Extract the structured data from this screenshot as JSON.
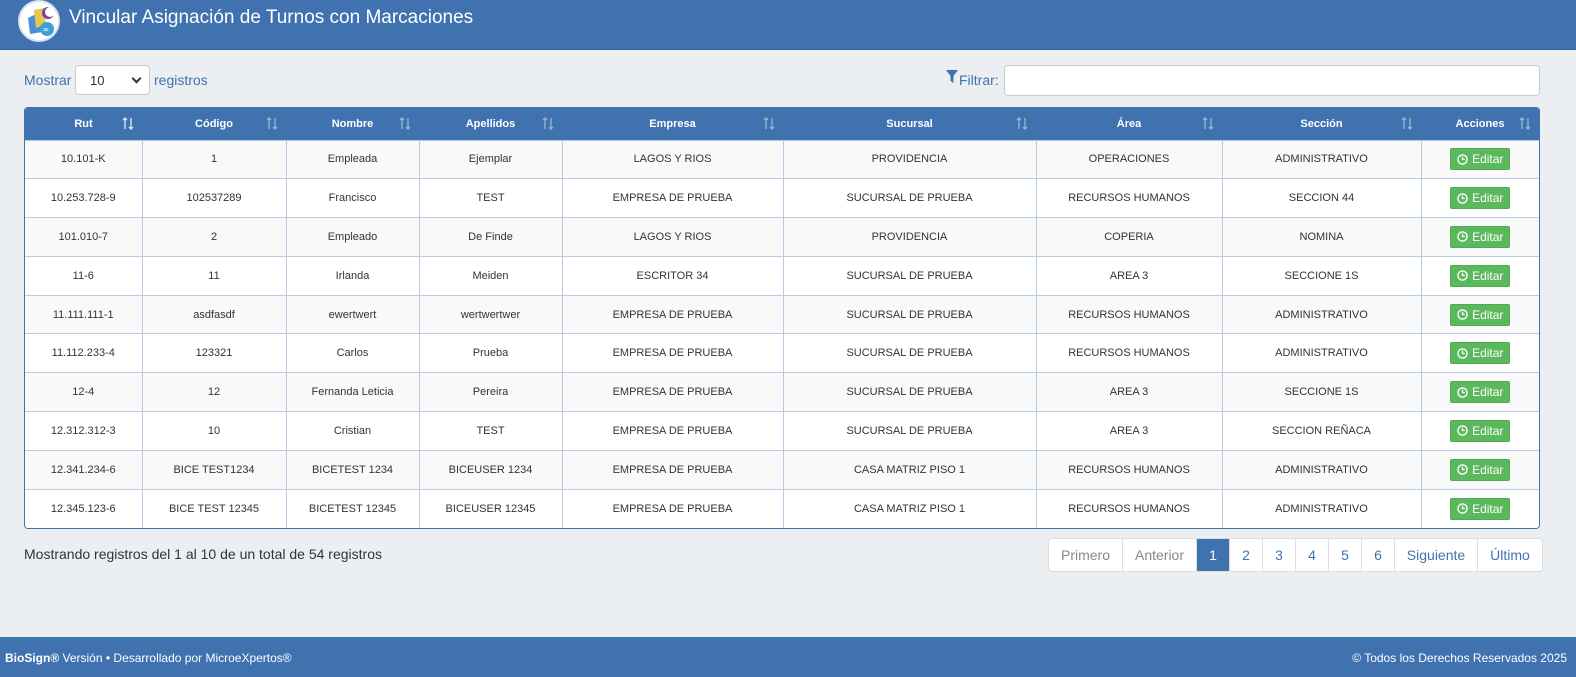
{
  "header": {
    "title": "Vincular Asignación de Turnos con Marcaciones",
    "logo_icon": "biosign-logo"
  },
  "controls": {
    "show_label": "Mostrar",
    "page_size": "10",
    "records_label": "registros",
    "filter_label": "Filtrar:",
    "filter_value": ""
  },
  "table": {
    "columns": [
      "Rut",
      "Código",
      "Nombre",
      "Apellidos",
      "Empresa",
      "Sucursal",
      "Área",
      "Sección",
      "Acciones"
    ],
    "edit_label": "Editar",
    "rows": [
      [
        "10.101-K",
        "1",
        "Empleada",
        "Ejemplar",
        "LAGOS Y RIOS",
        "PROVIDENCIA",
        "OPERACIONES",
        "ADMINISTRATIVO"
      ],
      [
        "10.253.728-9",
        "102537289",
        "Francisco",
        "TEST",
        "EMPRESA DE PRUEBA",
        "SUCURSAL DE PRUEBA",
        "RECURSOS HUMANOS",
        "SECCION 44"
      ],
      [
        "101.010-7",
        "2",
        "Empleado",
        "De Finde",
        "LAGOS Y RIOS",
        "PROVIDENCIA",
        "COPERIA",
        "NOMINA"
      ],
      [
        "11-6",
        "11",
        "Irlanda",
        "Meiden",
        "ESCRITOR 34",
        "SUCURSAL DE PRUEBA",
        "AREA 3",
        "SECCIONE 1S"
      ],
      [
        "11.111.111-1",
        "asdfasdf",
        "ewertwert",
        "wertwertwer",
        "EMPRESA DE PRUEBA",
        "SUCURSAL DE PRUEBA",
        "RECURSOS HUMANOS",
        "ADMINISTRATIVO"
      ],
      [
        "11.112.233-4",
        "123321",
        "Carlos",
        "Prueba",
        "EMPRESA DE PRUEBA",
        "SUCURSAL DE PRUEBA",
        "RECURSOS HUMANOS",
        "ADMINISTRATIVO"
      ],
      [
        "12-4",
        "12",
        "Fernanda Leticia",
        "Pereira",
        "EMPRESA DE PRUEBA",
        "SUCURSAL DE PRUEBA",
        "AREA 3",
        "SECCIONE 1S"
      ],
      [
        "12.312.312-3",
        "10",
        "Cristian",
        "TEST",
        "EMPRESA DE PRUEBA",
        "SUCURSAL DE PRUEBA",
        "AREA 3",
        "SECCION REÑACA"
      ],
      [
        "12.341.234-6",
        "BICE TEST1234",
        "BICETEST 1234",
        "BICEUSER 1234",
        "EMPRESA DE PRUEBA",
        "CASA MATRIZ PISO 1",
        "RECURSOS HUMANOS",
        "ADMINISTRATIVO"
      ],
      [
        "12.345.123-6",
        "BICE TEST 12345",
        "BICETEST 12345",
        "BICEUSER 12345",
        "EMPRESA DE PRUEBA",
        "CASA MATRIZ PISO 1",
        "RECURSOS HUMANOS",
        "ADMINISTRATIVO"
      ]
    ]
  },
  "info": "Mostrando registros del 1 al 10 de un total de 54 registros",
  "pagination": {
    "first": "Primero",
    "prev": "Anterior",
    "pages": [
      "1",
      "2",
      "3",
      "4",
      "5",
      "6"
    ],
    "current": "1",
    "next": "Siguiente",
    "last": "Último"
  },
  "footer": {
    "brand": "BioSign®",
    "left_text": " Versión • Desarrollado por MicroeXpertos®",
    "right_text": "© Todos los Derechos Reservados 2025"
  },
  "colors": {
    "primary": "#3f72af",
    "success": "#5cb85c",
    "background": "#eceff1"
  }
}
